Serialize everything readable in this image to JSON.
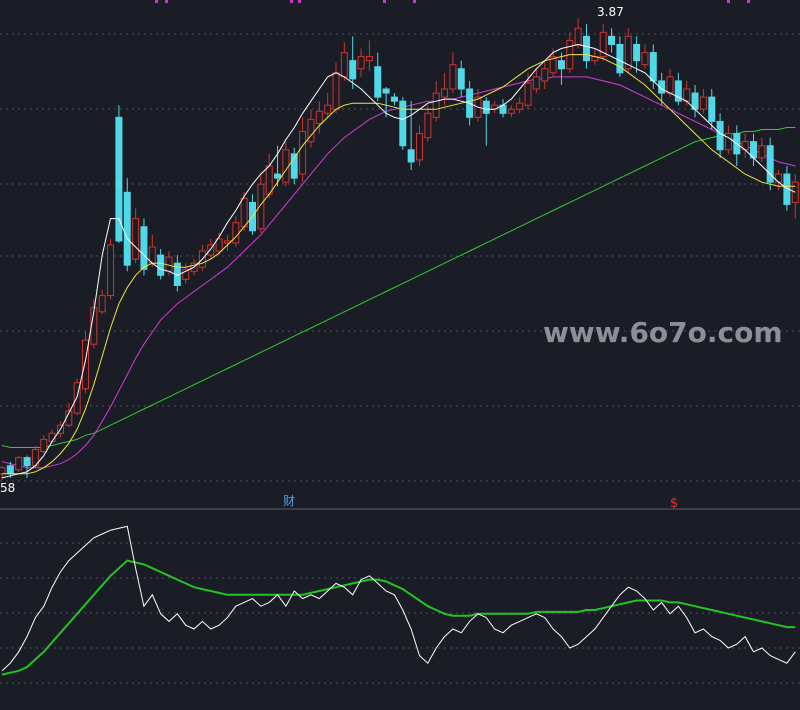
{
  "colors": {
    "background": "#1b1d26",
    "grid": "#4a4e5c",
    "up": "#d0342c",
    "down": "#4fd8e8",
    "ma5": "#ffffff",
    "ma10": "#f0e63c",
    "ma20": "#d43cd4",
    "ma60": "#2ecc2e",
    "osc_fast": "#ffffff",
    "osc_slow": "#22c422",
    "marker_top": "#c43cc4",
    "fin_marker": "#4fa0e8",
    "dollar_marker": "#e83030",
    "watermark": "#a0a3ab"
  },
  "chart_data": [
    {
      "type": "candlestick",
      "title": "",
      "ylabel": "",
      "ylim": [
        1.55,
        3.92
      ],
      "grid": true,
      "annotations": {
        "high_label": "3.87",
        "low_label": "58",
        "fin_marker": "财",
        "dollar_marker": "$"
      },
      "candles": [
        [
          1.62,
          1.65,
          1.59,
          1.66
        ],
        [
          1.66,
          1.62,
          1.6,
          1.68
        ],
        [
          1.64,
          1.7,
          1.63,
          1.71
        ],
        [
          1.7,
          1.66,
          1.6,
          1.71
        ],
        [
          1.66,
          1.74,
          1.65,
          1.76
        ],
        [
          1.73,
          1.79,
          1.72,
          1.81
        ],
        [
          1.78,
          1.82,
          1.77,
          1.84
        ],
        [
          1.82,
          1.86,
          1.8,
          1.88
        ],
        [
          1.86,
          1.93,
          1.85,
          1.97
        ],
        [
          1.92,
          2.07,
          1.91,
          2.09
        ],
        [
          2.04,
          2.28,
          2.02,
          2.32
        ],
        [
          2.26,
          2.44,
          2.24,
          2.48
        ],
        [
          2.42,
          2.5,
          2.41,
          2.53
        ],
        [
          2.5,
          2.75,
          2.48,
          2.78
        ],
        [
          3.38,
          2.77,
          2.76,
          3.44
        ],
        [
          3.01,
          2.65,
          2.62,
          3.08
        ],
        [
          2.68,
          2.88,
          2.66,
          2.93
        ],
        [
          2.84,
          2.63,
          2.6,
          2.88
        ],
        [
          2.66,
          2.74,
          2.64,
          2.8
        ],
        [
          2.7,
          2.6,
          2.58,
          2.73
        ],
        [
          2.62,
          2.69,
          2.6,
          2.72
        ],
        [
          2.66,
          2.55,
          2.52,
          2.7
        ],
        [
          2.58,
          2.63,
          2.56,
          2.66
        ],
        [
          2.62,
          2.66,
          2.6,
          2.68
        ],
        [
          2.64,
          2.72,
          2.62,
          2.75
        ],
        [
          2.7,
          2.75,
          2.68,
          2.78
        ],
        [
          2.72,
          2.78,
          2.7,
          2.81
        ],
        [
          2.76,
          2.77,
          2.72,
          2.8
        ],
        [
          2.76,
          2.86,
          2.74,
          2.89
        ],
        [
          2.84,
          2.98,
          2.82,
          3.01
        ],
        [
          2.96,
          2.82,
          2.8,
          3.0
        ],
        [
          2.83,
          3.05,
          2.81,
          3.11
        ],
        [
          3.0,
          3.14,
          2.98,
          3.2
        ],
        [
          3.1,
          3.08,
          3.04,
          3.24
        ],
        [
          3.06,
          3.22,
          3.04,
          3.26
        ],
        [
          3.2,
          3.08,
          3.05,
          3.23
        ],
        [
          3.1,
          3.31,
          3.06,
          3.38
        ],
        [
          3.26,
          3.37,
          3.23,
          3.42
        ],
        [
          3.35,
          3.41,
          3.3,
          3.46
        ],
        [
          3.4,
          3.44,
          3.38,
          3.5
        ],
        [
          3.42,
          3.6,
          3.4,
          3.65
        ],
        [
          3.58,
          3.7,
          3.56,
          3.75
        ],
        [
          3.66,
          3.57,
          3.52,
          3.78
        ],
        [
          3.62,
          3.68,
          3.58,
          3.72
        ],
        [
          3.66,
          3.68,
          3.61,
          3.76
        ],
        [
          3.63,
          3.48,
          3.46,
          3.7
        ],
        [
          3.52,
          3.5,
          3.38,
          3.53
        ],
        [
          3.48,
          3.46,
          3.44,
          3.5
        ],
        [
          3.46,
          3.24,
          3.22,
          3.48
        ],
        [
          3.22,
          3.16,
          3.12,
          3.46
        ],
        [
          3.17,
          3.3,
          3.14,
          3.34
        ],
        [
          3.28,
          3.4,
          3.26,
          3.44
        ],
        [
          3.38,
          3.5,
          3.36,
          3.56
        ],
        [
          3.48,
          3.52,
          3.44,
          3.6
        ],
        [
          3.52,
          3.64,
          3.5,
          3.7
        ],
        [
          3.62,
          3.52,
          3.48,
          3.66
        ],
        [
          3.52,
          3.38,
          3.34,
          3.56
        ],
        [
          3.38,
          3.48,
          3.36,
          3.52
        ],
        [
          3.46,
          3.4,
          3.24,
          3.48
        ],
        [
          3.42,
          3.44,
          3.4,
          3.46
        ],
        [
          3.44,
          3.4,
          3.38,
          3.47
        ],
        [
          3.4,
          3.42,
          3.38,
          3.44
        ],
        [
          3.42,
          3.45,
          3.4,
          3.48
        ],
        [
          3.44,
          3.55,
          3.42,
          3.6
        ],
        [
          3.52,
          3.58,
          3.5,
          3.62
        ],
        [
          3.56,
          3.62,
          3.52,
          3.66
        ],
        [
          3.6,
          3.68,
          3.58,
          3.72
        ],
        [
          3.66,
          3.62,
          3.54,
          3.7
        ],
        [
          3.62,
          3.76,
          3.6,
          3.8
        ],
        [
          3.74,
          3.82,
          3.72,
          3.87
        ],
        [
          3.78,
          3.66,
          3.62,
          3.84
        ],
        [
          3.66,
          3.68,
          3.64,
          3.72
        ],
        [
          3.68,
          3.8,
          3.66,
          3.84
        ],
        [
          3.78,
          3.74,
          3.7,
          3.82
        ],
        [
          3.74,
          3.6,
          3.58,
          3.78
        ],
        [
          3.62,
          3.78,
          3.6,
          3.82
        ],
        [
          3.74,
          3.66,
          3.6,
          3.78
        ],
        [
          3.64,
          3.7,
          3.62,
          3.74
        ],
        [
          3.7,
          3.56,
          3.52,
          3.74
        ],
        [
          3.56,
          3.5,
          3.44,
          3.6
        ],
        [
          3.5,
          3.58,
          3.48,
          3.62
        ],
        [
          3.56,
          3.46,
          3.44,
          3.6
        ],
        [
          3.46,
          3.52,
          3.44,
          3.56
        ],
        [
          3.5,
          3.42,
          3.38,
          3.54
        ],
        [
          3.42,
          3.48,
          3.4,
          3.52
        ],
        [
          3.48,
          3.36,
          3.32,
          3.52
        ],
        [
          3.36,
          3.22,
          3.18,
          3.4
        ],
        [
          3.22,
          3.3,
          3.2,
          3.34
        ],
        [
          3.3,
          3.2,
          3.14,
          3.34
        ],
        [
          3.22,
          3.26,
          3.18,
          3.3
        ],
        [
          3.26,
          3.18,
          3.14,
          3.3
        ],
        [
          3.18,
          3.24,
          3.16,
          3.28
        ],
        [
          3.24,
          3.06,
          3.02,
          3.28
        ],
        [
          3.06,
          3.1,
          3.02,
          3.12
        ],
        [
          3.1,
          2.95,
          2.92,
          3.14
        ],
        [
          2.96,
          3.06,
          2.88,
          3.1
        ],
        [
          3.04,
          3.0,
          2.96,
          3.08
        ],
        [
          3.0,
          3.04,
          2.98,
          3.06
        ]
      ],
      "ma5": [
        1.6,
        1.61,
        1.62,
        1.63,
        1.66,
        1.71,
        1.78,
        1.84,
        1.92,
        2.0,
        2.18,
        2.42,
        2.7,
        2.88,
        2.88,
        2.78,
        2.74,
        2.7,
        2.66,
        2.63,
        2.62,
        2.6,
        2.62,
        2.64,
        2.68,
        2.73,
        2.79,
        2.86,
        2.92,
        2.99,
        3.05,
        3.1,
        3.14,
        3.2,
        3.27,
        3.33,
        3.4,
        3.46,
        3.52,
        3.58,
        3.6,
        3.58,
        3.55,
        3.52,
        3.48,
        3.44,
        3.4,
        3.38,
        3.37,
        3.39,
        3.42,
        3.45,
        3.46,
        3.47,
        3.47,
        3.46,
        3.45,
        3.43,
        3.42,
        3.42,
        3.44,
        3.47,
        3.52,
        3.57,
        3.62,
        3.66,
        3.7,
        3.72,
        3.73,
        3.74,
        3.73,
        3.72,
        3.7,
        3.68,
        3.66,
        3.64,
        3.62,
        3.6,
        3.56,
        3.52,
        3.5,
        3.48,
        3.46,
        3.42,
        3.38,
        3.34,
        3.3,
        3.28,
        3.25,
        3.22,
        3.18,
        3.14,
        3.1,
        3.06,
        3.03,
        3.01
      ],
      "ma10": [
        1.62,
        1.62,
        1.62,
        1.62,
        1.63,
        1.65,
        1.68,
        1.72,
        1.77,
        1.84,
        1.94,
        2.06,
        2.2,
        2.34,
        2.46,
        2.54,
        2.6,
        2.64,
        2.66,
        2.66,
        2.65,
        2.64,
        2.64,
        2.65,
        2.66,
        2.68,
        2.71,
        2.75,
        2.79,
        2.84,
        2.89,
        2.95,
        3.0,
        3.06,
        3.12,
        3.18,
        3.24,
        3.29,
        3.34,
        3.38,
        3.42,
        3.44,
        3.45,
        3.45,
        3.45,
        3.45,
        3.44,
        3.43,
        3.42,
        3.42,
        3.42,
        3.42,
        3.42,
        3.43,
        3.44,
        3.45,
        3.46,
        3.47,
        3.49,
        3.51,
        3.53,
        3.56,
        3.59,
        3.62,
        3.64,
        3.66,
        3.67,
        3.68,
        3.69,
        3.69,
        3.69,
        3.68,
        3.67,
        3.65,
        3.63,
        3.6,
        3.57,
        3.54,
        3.5,
        3.46,
        3.42,
        3.38,
        3.34,
        3.3,
        3.26,
        3.22,
        3.19,
        3.16,
        3.13,
        3.1,
        3.08,
        3.06,
        3.05,
        3.04,
        3.04,
        3.04
      ],
      "ma20": [
        1.68,
        1.67,
        1.66,
        1.65,
        1.65,
        1.65,
        1.66,
        1.67,
        1.69,
        1.72,
        1.76,
        1.81,
        1.88,
        1.95,
        2.03,
        2.11,
        2.19,
        2.26,
        2.32,
        2.38,
        2.42,
        2.46,
        2.49,
        2.52,
        2.55,
        2.58,
        2.61,
        2.64,
        2.68,
        2.72,
        2.76,
        2.8,
        2.85,
        2.9,
        2.95,
        3.0,
        3.05,
        3.1,
        3.15,
        3.2,
        3.24,
        3.28,
        3.31,
        3.34,
        3.37,
        3.39,
        3.41,
        3.42,
        3.43,
        3.44,
        3.45,
        3.46,
        3.46,
        3.47,
        3.47,
        3.48,
        3.49,
        3.5,
        3.51,
        3.52,
        3.53,
        3.54,
        3.55,
        3.56,
        3.57,
        3.57,
        3.58,
        3.58,
        3.58,
        3.58,
        3.58,
        3.57,
        3.56,
        3.55,
        3.54,
        3.52,
        3.5,
        3.48,
        3.46,
        3.44,
        3.42,
        3.4,
        3.38,
        3.36,
        3.34,
        3.32,
        3.3,
        3.28,
        3.26,
        3.24,
        3.22,
        3.2,
        3.18,
        3.16,
        3.15,
        3.14
      ],
      "ma60": [
        1.76,
        1.75,
        1.75,
        1.75,
        1.75,
        1.75,
        1.76,
        1.77,
        1.78,
        1.79,
        1.81,
        1.82,
        1.84,
        1.86,
        1.88,
        1.9,
        1.92,
        1.94,
        1.96,
        1.98,
        2.0,
        2.02,
        2.04,
        2.06,
        2.08,
        2.1,
        2.12,
        2.14,
        2.16,
        2.18,
        2.2,
        2.22,
        2.24,
        2.26,
        2.28,
        2.3,
        2.32,
        2.34,
        2.36,
        2.38,
        2.4,
        2.42,
        2.44,
        2.46,
        2.48,
        2.5,
        2.52,
        2.54,
        2.56,
        2.58,
        2.6,
        2.62,
        2.64,
        2.66,
        2.68,
        2.7,
        2.72,
        2.74,
        2.76,
        2.78,
        2.8,
        2.82,
        2.84,
        2.86,
        2.88,
        2.9,
        2.92,
        2.94,
        2.96,
        2.98,
        3.0,
        3.02,
        3.04,
        3.06,
        3.08,
        3.1,
        3.12,
        3.14,
        3.16,
        3.18,
        3.2,
        3.22,
        3.24,
        3.26,
        3.27,
        3.28,
        3.29,
        3.3,
        3.3,
        3.31,
        3.31,
        3.32,
        3.32,
        3.32,
        3.33,
        3.33
      ]
    },
    {
      "type": "line",
      "title": "",
      "ylabel": "",
      "ylim": [
        0,
        100
      ],
      "grid": true,
      "series": [
        {
          "values": [
            18,
            22,
            28,
            36,
            46,
            52,
            62,
            70,
            76,
            80,
            84,
            88,
            90,
            92,
            93,
            94,
            72,
            52,
            58,
            48,
            44,
            48,
            42,
            40,
            44,
            40,
            42,
            46,
            52,
            54,
            56,
            52,
            54,
            58,
            52,
            60,
            56,
            58,
            56,
            60,
            64,
            62,
            58,
            66,
            68,
            64,
            60,
            58,
            50,
            40,
            26,
            22,
            30,
            36,
            40,
            38,
            44,
            48,
            46,
            40,
            38,
            42,
            44,
            46,
            48,
            46,
            40,
            36,
            30,
            32,
            36,
            40,
            46,
            52,
            58,
            62,
            60,
            56,
            50,
            54,
            48,
            52,
            46,
            38,
            40,
            36,
            34,
            30,
            32,
            36,
            28,
            30,
            26,
            24,
            22,
            28
          ]
        },
        {
          "values": [
            16,
            17,
            18,
            20,
            24,
            28,
            33,
            38,
            43,
            48,
            53,
            58,
            63,
            68,
            72,
            76,
            75,
            74,
            72,
            70,
            68,
            66,
            64,
            62,
            61,
            60,
            59,
            58,
            58,
            58,
            58,
            58,
            58,
            58,
            58,
            58,
            58,
            59,
            60,
            61,
            62,
            63,
            64,
            65,
            66,
            66,
            65,
            63,
            61,
            58,
            55,
            52,
            50,
            48,
            47,
            47,
            47,
            48,
            48,
            48,
            48,
            48,
            48,
            48,
            49,
            49,
            49,
            49,
            49,
            49,
            50,
            50,
            51,
            52,
            53,
            54,
            55,
            55,
            55,
            55,
            54,
            54,
            53,
            52,
            51,
            50,
            49,
            48,
            47,
            46,
            45,
            44,
            43,
            42,
            41,
            41
          ]
        }
      ]
    }
  ],
  "watermark": "www.6o7o.com"
}
